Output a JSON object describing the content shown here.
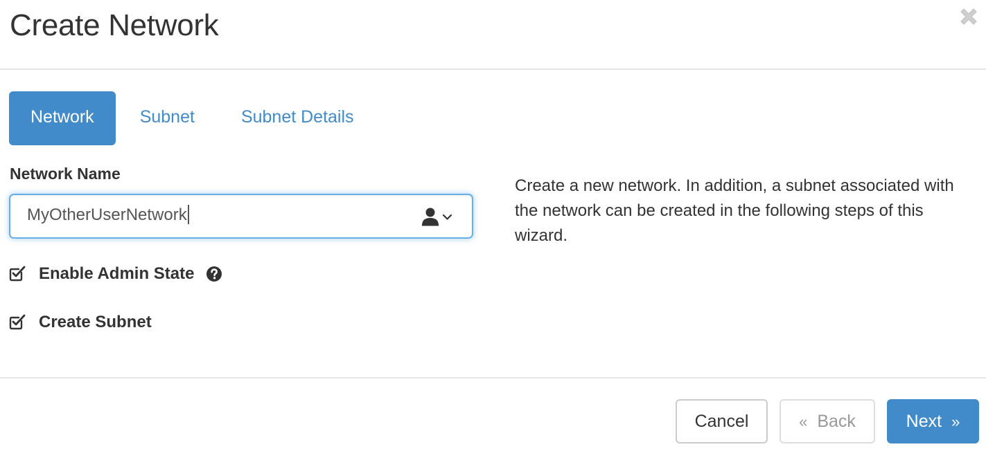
{
  "dialog": {
    "title": "Create Network"
  },
  "tabs": [
    {
      "label": "Network",
      "active": true
    },
    {
      "label": "Subnet",
      "active": false
    },
    {
      "label": "Subnet Details",
      "active": false
    }
  ],
  "network_name": {
    "label": "Network Name",
    "value": "MyOtherUserNetwork",
    "icon": "user-icon"
  },
  "checkboxes": [
    {
      "label": "Enable Admin State",
      "checked": true,
      "help_icon": "question-circle-icon"
    },
    {
      "label": "Create Subnet",
      "checked": true
    }
  ],
  "help_text": "Create a new network. In addition, a subnet associated with the network can be created in the following steps of this wizard.",
  "footer": {
    "cancel_label": "Cancel",
    "back_label": "Back",
    "back_arrow": "«",
    "next_label": "Next",
    "next_arrow": "»"
  },
  "colors": {
    "primary": "#428bca",
    "focus_border": "#66afe9",
    "text": "#333333",
    "muted": "#999999"
  }
}
